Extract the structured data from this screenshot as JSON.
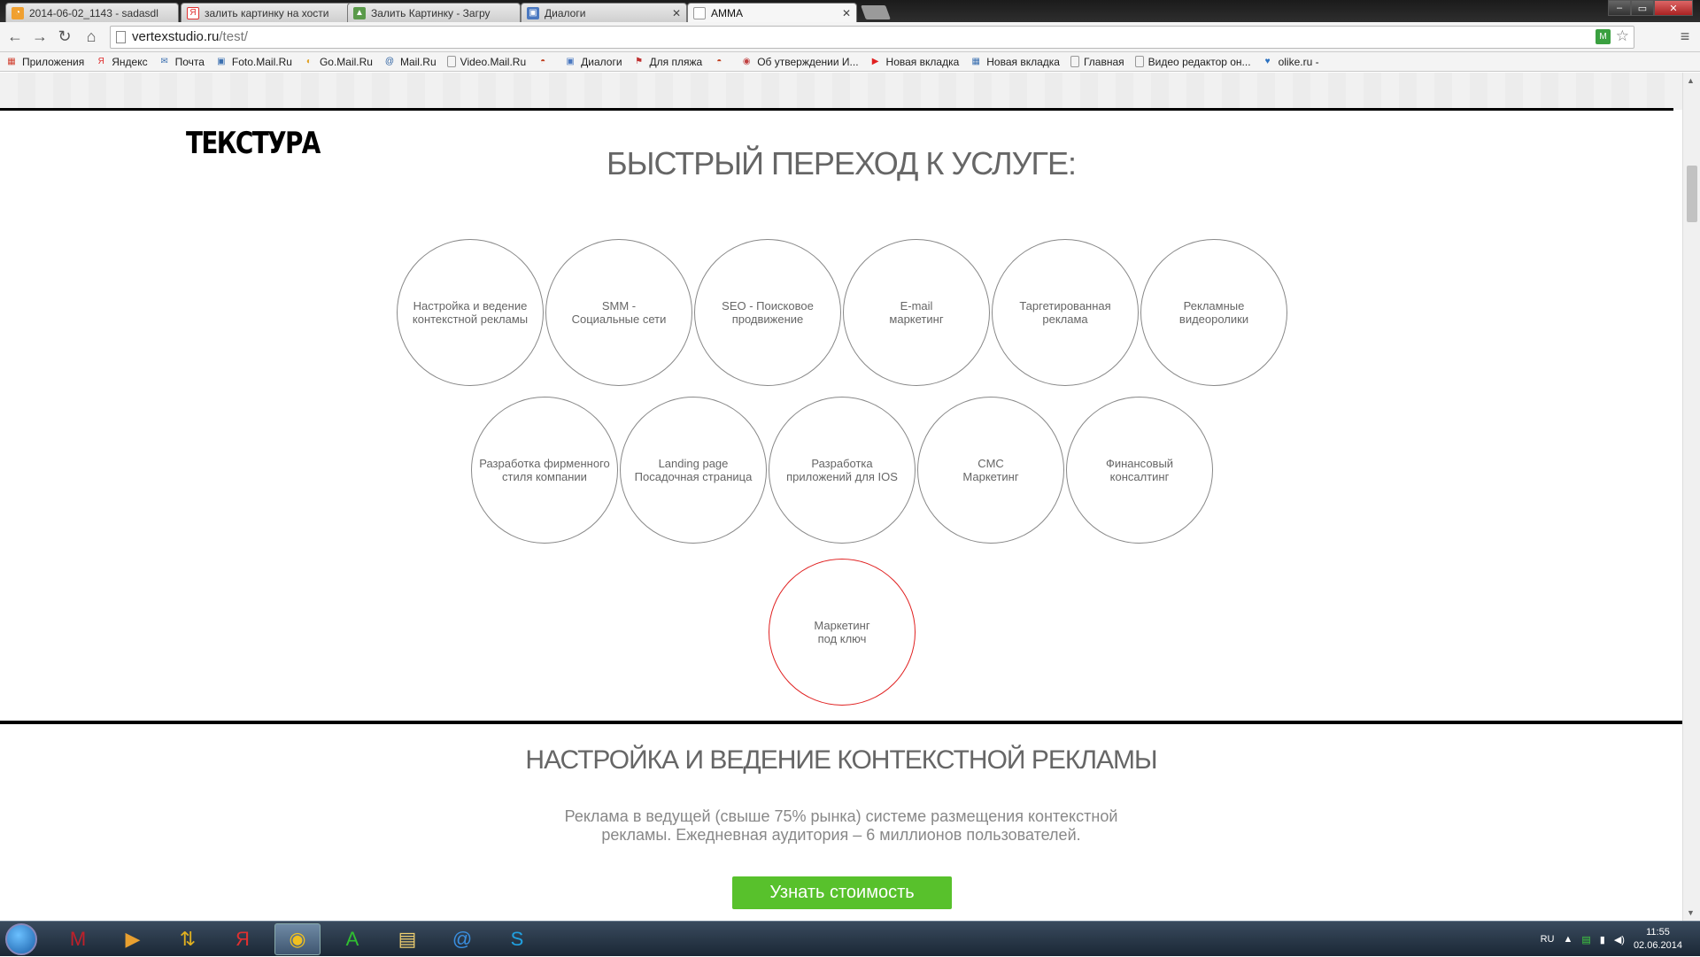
{
  "browser": {
    "tabs": [
      {
        "title": "2014-06-02_1143 - sadasdl",
        "icon_color": "#f0a030",
        "icon": "rss-icon"
      },
      {
        "title": "залить картинку на хости",
        "icon_color": "#e03030",
        "icon": "yandex-icon"
      },
      {
        "title": "Залить Картинку - Загру",
        "icon_color": "#5a9a4a",
        "icon": "image-icon"
      },
      {
        "title": "Диалоги",
        "icon_color": "#4a78c0",
        "icon": "dialog-icon"
      },
      {
        "title": "AMMA",
        "icon_color": "#999999",
        "icon": "page-icon"
      }
    ],
    "url_host": "vertexstudio.ru",
    "url_path": "/test/",
    "bookmarks": [
      {
        "label": "Приложения",
        "icon": "apps-icon",
        "color": "#d04030"
      },
      {
        "label": "Яндекс",
        "icon": "yandex-icon",
        "color": "#e03030"
      },
      {
        "label": "Почта",
        "icon": "mail-icon",
        "color": "#3a6fb0"
      },
      {
        "label": "Foto.Mail.Ru",
        "icon": "photo-icon",
        "color": "#3a6fb0"
      },
      {
        "label": "Go.Mail.Ru",
        "icon": "search-icon",
        "color": "#e0a020"
      },
      {
        "label": "Mail.Ru",
        "icon": "at-icon",
        "color": "#2a5fa0"
      },
      {
        "label": "Video.Mail.Ru",
        "icon": "page-icon",
        "color": "#999999"
      },
      {
        "label": "",
        "icon": "burger-icon",
        "color": "#c04020"
      },
      {
        "label": "Диалоги",
        "icon": "dialog-icon",
        "color": "#4a78c0"
      },
      {
        "label": "Для пляжа",
        "icon": "flag-icon",
        "color": "#c03030"
      },
      {
        "label": "",
        "icon": "burger-icon",
        "color": "#c04020"
      },
      {
        "label": "Об утверждении И...",
        "icon": "document-icon",
        "color": "#c04040"
      },
      {
        "label": "Новая вкладка",
        "icon": "youtube-icon",
        "color": "#e02020"
      },
      {
        "label": "Новая вкладка",
        "icon": "grid-icon",
        "color": "#3a6fb0"
      },
      {
        "label": "Главная",
        "icon": "page-icon",
        "color": "#999999"
      },
      {
        "label": "Видео редактор он...",
        "icon": "page-icon",
        "color": "#999999"
      },
      {
        "label": "olike.ru -",
        "icon": "heart-icon",
        "color": "#2a70c0"
      }
    ]
  },
  "page": {
    "logo": "ТЕКСТУРА",
    "heading": "БЫСТРЫЙ ПЕРЕХОД К УСЛУГЕ:",
    "services_row1": [
      "Настройка и ведение\nконтекстной рекламы",
      "SMM -\nСоциальные сети",
      "SEO - Поисковое\nпродвижение",
      "E-mail\nмаркетинг",
      "Таргетированная\nреклама",
      "Рекламные\nвидеоролики"
    ],
    "services_row2": [
      "Разработка фирменного\nстиля компании",
      "Landing page\nПосадочная страница",
      "Разработка\nприложений для IOS",
      "CMC\nМаркетинг",
      "Финансовый\nконсалтинг"
    ],
    "services_row3": [
      "Маркетинг\nпод ключ"
    ],
    "highlight_color": "#e02020",
    "section_title": "НАСТРОЙКА И ВЕДЕНИЕ КОНТЕКСТНОЙ РЕКЛАМЫ",
    "section_desc": "Реклама в ведущей (свыше 75% рынка) системе размещения контекстной рекламы. Ежедневная аудитория – 6 миллионов пользователей.",
    "cta_label": "Узнать стоимость",
    "cta_color": "#58c12c"
  },
  "taskbar": {
    "apps": [
      {
        "name": "mcafee-icon",
        "glyph": "M",
        "color": "#c0202a"
      },
      {
        "name": "media-player-icon",
        "glyph": "▶",
        "color": "#e8a030"
      },
      {
        "name": "torrent-icon",
        "glyph": "⇅",
        "color": "#e0b020"
      },
      {
        "name": "yandex-browser-icon",
        "glyph": "Я",
        "color": "#e03030"
      },
      {
        "name": "chrome-icon",
        "glyph": "◉",
        "color": "#f0c020"
      },
      {
        "name": "font-app-icon",
        "glyph": "A",
        "color": "#30c030"
      },
      {
        "name": "folder-icon",
        "glyph": "▤",
        "color": "#f0d070"
      },
      {
        "name": "mail-agent-icon",
        "glyph": "@",
        "color": "#3a8fe0"
      },
      {
        "name": "skype-icon",
        "glyph": "S",
        "color": "#20a0e0"
      }
    ],
    "lang": "RU",
    "time": "11:55",
    "date": "02.06.2014"
  }
}
